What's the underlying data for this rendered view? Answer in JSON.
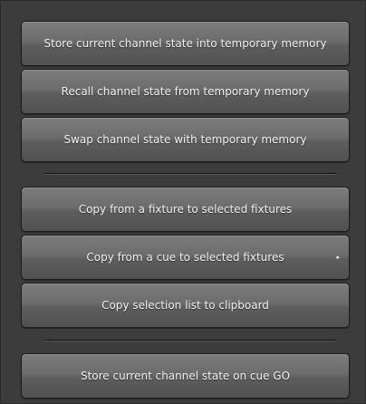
{
  "menu": {
    "group1": [
      {
        "label": "Store current channel state into temporary memory"
      },
      {
        "label": "Recall channel state from temporary memory"
      },
      {
        "label": "Swap channel state with temporary memory"
      }
    ],
    "group2": [
      {
        "label": "Copy from a fixture to selected fixtures"
      },
      {
        "label": "Copy from a cue to selected fixtures",
        "submenu_glyph": "▸"
      },
      {
        "label": "Copy selection list to clipboard"
      }
    ],
    "group3": [
      {
        "label": "Store current channel state on cue GO"
      }
    ]
  }
}
